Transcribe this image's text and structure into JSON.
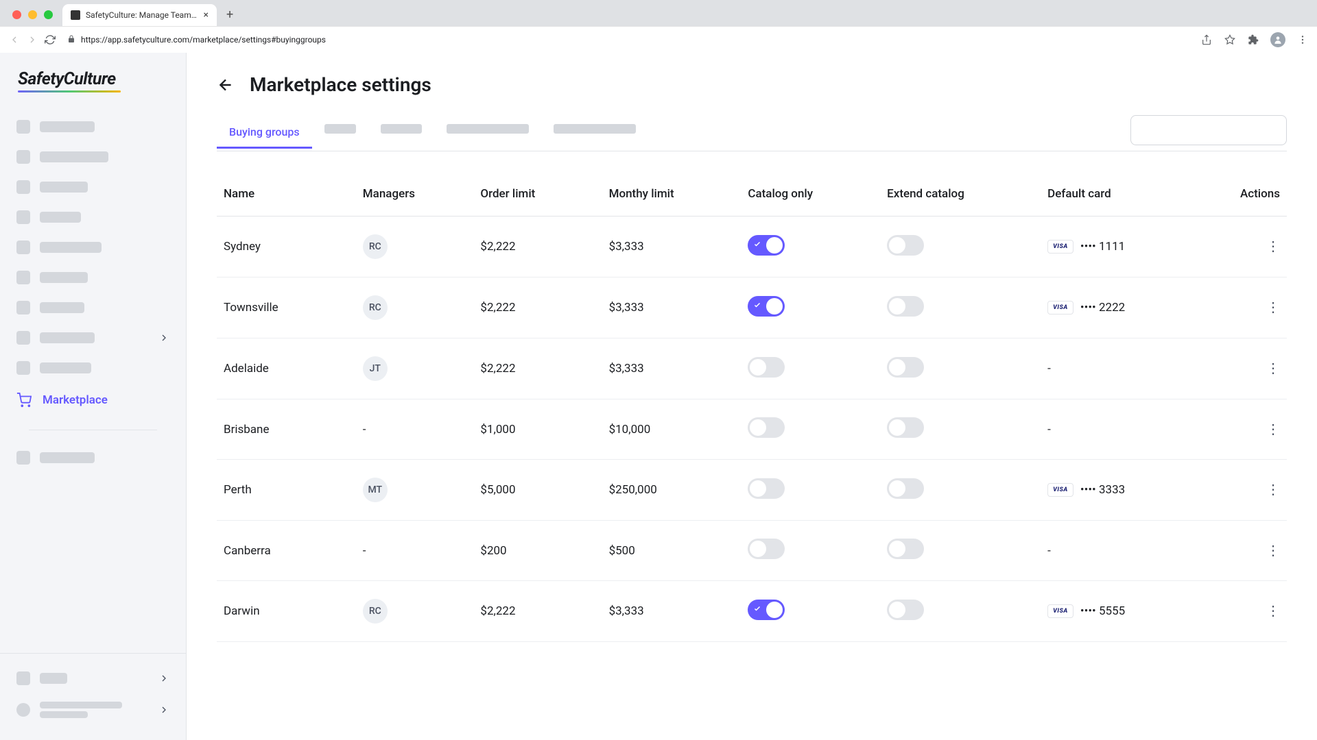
{
  "browser": {
    "tab_title": "SafetyCulture: Manage Teams and ...",
    "url": "https://app.safetyculture.com/marketplace/settings#buyinggroups"
  },
  "sidebar": {
    "logo": "SafetyCulture",
    "active_item": "Marketplace"
  },
  "page": {
    "title": "Marketplace settings",
    "active_tab": "Buying groups"
  },
  "table": {
    "headers": {
      "name": "Name",
      "managers": "Managers",
      "order_limit": "Order limit",
      "monthly_limit": "Monthy limit",
      "catalog_only": "Catalog only",
      "extend_catalog": "Extend catalog",
      "default_card": "Default card",
      "actions": "Actions"
    },
    "rows": [
      {
        "name": "Sydney",
        "manager": "RC",
        "order_limit": "$2,222",
        "monthly_limit": "$3,333",
        "catalog_only": true,
        "extend_catalog": false,
        "card_brand": "VISA",
        "card_last4": "1111"
      },
      {
        "name": "Townsville",
        "manager": "RC",
        "order_limit": "$2,222",
        "monthly_limit": "$3,333",
        "catalog_only": true,
        "extend_catalog": false,
        "card_brand": "VISA",
        "card_last4": "2222"
      },
      {
        "name": "Adelaide",
        "manager": "JT",
        "order_limit": "$2,222",
        "monthly_limit": "$3,333",
        "catalog_only": false,
        "extend_catalog": false,
        "card_brand": null,
        "card_last4": null
      },
      {
        "name": "Brisbane",
        "manager": null,
        "order_limit": "$1,000",
        "monthly_limit": "$10,000",
        "catalog_only": false,
        "extend_catalog": false,
        "card_brand": null,
        "card_last4": null
      },
      {
        "name": "Perth",
        "manager": "MT",
        "order_limit": "$5,000",
        "monthly_limit": "$250,000",
        "catalog_only": false,
        "extend_catalog": false,
        "card_brand": "VISA",
        "card_last4": "3333"
      },
      {
        "name": "Canberra",
        "manager": null,
        "order_limit": "$200",
        "monthly_limit": "$500",
        "catalog_only": false,
        "extend_catalog": false,
        "card_brand": null,
        "card_last4": null
      },
      {
        "name": "Darwin",
        "manager": "RC",
        "order_limit": "$2,222",
        "monthly_limit": "$3,333",
        "catalog_only": true,
        "extend_catalog": false,
        "card_brand": "VISA",
        "card_last4": "5555"
      }
    ]
  }
}
